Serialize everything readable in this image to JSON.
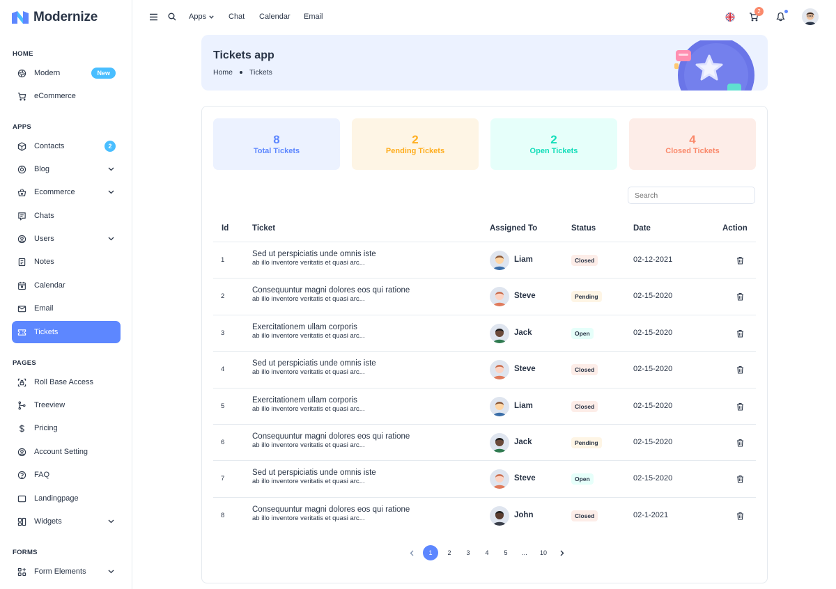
{
  "app": {
    "name": "Modernize"
  },
  "sidebar": {
    "sections": [
      {
        "title": "HOME"
      },
      {
        "title": "APPS"
      },
      {
        "title": "PAGES"
      },
      {
        "title": "FORMS"
      }
    ],
    "items": [
      {
        "label": "Modern",
        "badge": "New"
      },
      {
        "label": "eCommerce"
      },
      {
        "label": "Contacts",
        "badge": "2"
      },
      {
        "label": "Blog"
      },
      {
        "label": "Ecommerce"
      },
      {
        "label": "Chats"
      },
      {
        "label": "Users"
      },
      {
        "label": "Notes"
      },
      {
        "label": "Calendar"
      },
      {
        "label": "Email"
      },
      {
        "label": "Tickets"
      },
      {
        "label": "Roll Base Access"
      },
      {
        "label": "Treeview"
      },
      {
        "label": "Pricing"
      },
      {
        "label": "Account Setting"
      },
      {
        "label": "FAQ"
      },
      {
        "label": "Landingpage"
      },
      {
        "label": "Widgets"
      },
      {
        "label": "Form Elements"
      }
    ]
  },
  "topbar": {
    "links": [
      "Apps",
      "Chat",
      "Calendar",
      "Email"
    ],
    "cart_count": "2"
  },
  "banner": {
    "title": "Tickets app",
    "breadcrumb": [
      "Home",
      "Tickets"
    ]
  },
  "stats": [
    {
      "value": "8",
      "label": "Total Tickets",
      "color": "#5d87ff",
      "bg": "#ecf2ff"
    },
    {
      "value": "2",
      "label": "Pending Tickets",
      "color": "#ffae1f",
      "bg": "#fef5e5"
    },
    {
      "value": "2",
      "label": "Open Tickets",
      "color": "#13deb9",
      "bg": "#e6fffa"
    },
    {
      "value": "4",
      "label": "Closed Tickets",
      "color": "#fa896b",
      "bg": "#fdede8"
    }
  ],
  "search": {
    "placeholder": "Search"
  },
  "table": {
    "headers": [
      "Id",
      "Ticket",
      "Assigned To",
      "Status",
      "Date",
      "Action"
    ],
    "rows": [
      {
        "id": "1",
        "title": "Sed ut perspiciatis unde omnis iste",
        "desc": "ab illo inventore veritatis et quasi arc...",
        "assignee": "Liam",
        "status": "Closed",
        "date": "02-12-2021"
      },
      {
        "id": "2",
        "title": "Consequuntur magni dolores eos qui ratione",
        "desc": "ab illo inventore veritatis et quasi arc...",
        "assignee": "Steve",
        "status": "Pending",
        "date": "02-15-2020"
      },
      {
        "id": "3",
        "title": "Exercitationem ullam corporis",
        "desc": "ab illo inventore veritatis et quasi arc...",
        "assignee": "Jack",
        "status": "Open",
        "date": "02-15-2020"
      },
      {
        "id": "4",
        "title": "Sed ut perspiciatis unde omnis iste",
        "desc": "ab illo inventore veritatis et quasi arc...",
        "assignee": "Steve",
        "status": "Closed",
        "date": "02-15-2020"
      },
      {
        "id": "5",
        "title": "Exercitationem ullam corporis",
        "desc": "ab illo inventore veritatis et quasi arc...",
        "assignee": "Liam",
        "status": "Closed",
        "date": "02-15-2020"
      },
      {
        "id": "6",
        "title": "Consequuntur magni dolores eos qui ratione",
        "desc": "ab illo inventore veritatis et quasi arc...",
        "assignee": "Jack",
        "status": "Pending",
        "date": "02-15-2020"
      },
      {
        "id": "7",
        "title": "Sed ut perspiciatis unde omnis iste",
        "desc": "ab illo inventore veritatis et quasi arc...",
        "assignee": "Steve",
        "status": "Open",
        "date": "02-15-2020"
      },
      {
        "id": "8",
        "title": "Consequuntur magni dolores eos qui ratione",
        "desc": "ab illo inventore veritatis et quasi arc...",
        "assignee": "John",
        "status": "Closed",
        "date": "02-1-2021"
      }
    ]
  },
  "pagination": {
    "pages": [
      "1",
      "2",
      "3",
      "4",
      "5",
      "...",
      "10"
    ],
    "current": "1"
  }
}
